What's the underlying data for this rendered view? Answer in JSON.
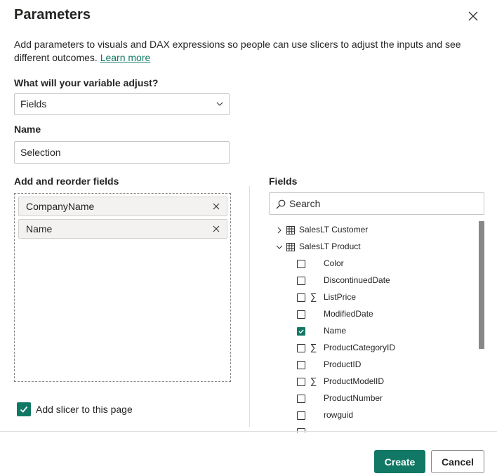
{
  "dialog": {
    "title": "Parameters",
    "description": "Add parameters to visuals and DAX expressions so people can use slicers to adjust the inputs and see different outcomes.",
    "learn_more": "Learn more"
  },
  "variable": {
    "label": "What will your variable adjust?",
    "selected": "Fields"
  },
  "name": {
    "label": "Name",
    "value": "Selection"
  },
  "reorder": {
    "label": "Add and reorder fields",
    "chips": [
      "CompanyName",
      "Name"
    ]
  },
  "slicer": {
    "label": "Add slicer to this page",
    "checked": true
  },
  "fields_panel": {
    "label": "Fields",
    "search_placeholder": "Search",
    "tables": [
      {
        "name": "SalesLT Customer",
        "expanded": false
      },
      {
        "name": "SalesLT Product",
        "expanded": true
      }
    ],
    "fields": [
      {
        "name": "Color",
        "checked": false,
        "sigma": false
      },
      {
        "name": "DiscontinuedDate",
        "checked": false,
        "sigma": false
      },
      {
        "name": "ListPrice",
        "checked": false,
        "sigma": true
      },
      {
        "name": "ModifiedDate",
        "checked": false,
        "sigma": false
      },
      {
        "name": "Name",
        "checked": true,
        "sigma": false
      },
      {
        "name": "ProductCategoryID",
        "checked": false,
        "sigma": true
      },
      {
        "name": "ProductID",
        "checked": false,
        "sigma": false
      },
      {
        "name": "ProductModelID",
        "checked": false,
        "sigma": true
      },
      {
        "name": "ProductNumber",
        "checked": false,
        "sigma": false
      },
      {
        "name": "rowguid",
        "checked": false,
        "sigma": false
      }
    ]
  },
  "buttons": {
    "create": "Create",
    "cancel": "Cancel"
  },
  "colors": {
    "accent": "#117865",
    "text": "#252423",
    "border": "#c8c6c4"
  }
}
